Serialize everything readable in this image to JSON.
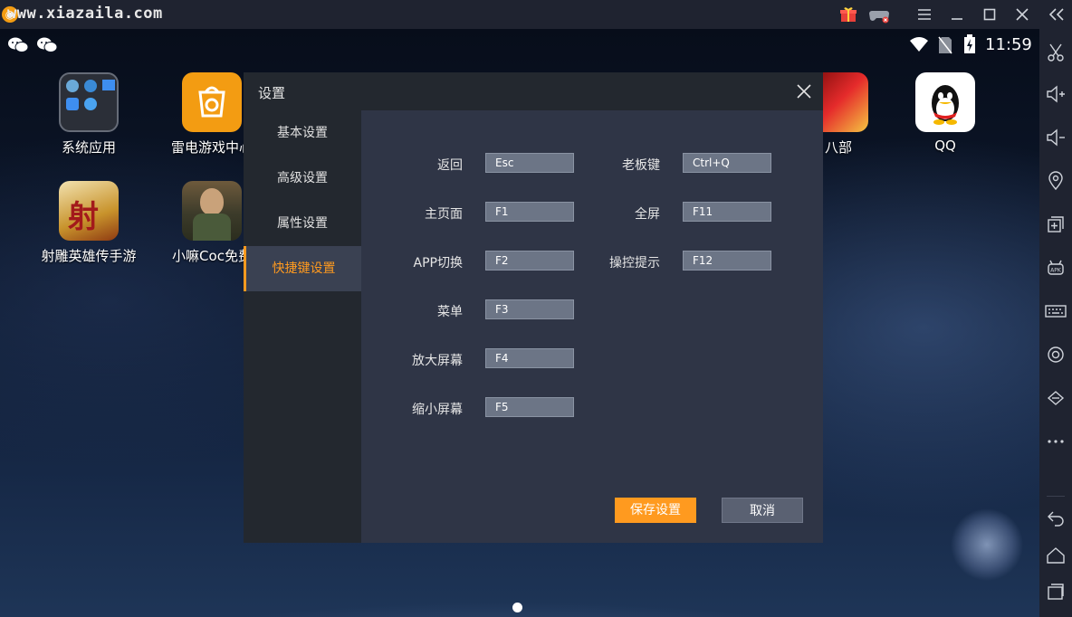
{
  "window": {
    "title": "www.xiazaila.com"
  },
  "status": {
    "time": "11:59"
  },
  "apps": [
    {
      "label": "系统应用"
    },
    {
      "label": "雷电游戏中心"
    },
    {
      "label": "八部"
    },
    {
      "label": "QQ"
    },
    {
      "label": "射雕英雄传手游"
    },
    {
      "label": "小嘛Coc免费"
    }
  ],
  "dialog": {
    "title": "设置",
    "nav": [
      {
        "label": "基本设置"
      },
      {
        "label": "高级设置"
      },
      {
        "label": "属性设置"
      },
      {
        "label": "快捷键设置"
      }
    ],
    "active_nav": "快捷键设置",
    "shortcuts_left": [
      {
        "label": "返回",
        "key": "Esc"
      },
      {
        "label": "主页面",
        "key": "F1"
      },
      {
        "label": "APP切换",
        "key": "F2"
      },
      {
        "label": "菜单",
        "key": "F3"
      },
      {
        "label": "放大屏幕",
        "key": "F4"
      },
      {
        "label": "缩小屏幕",
        "key": "F5"
      }
    ],
    "shortcuts_right": [
      {
        "label": "老板键",
        "key": "Ctrl+Q"
      },
      {
        "label": "全屏",
        "key": "F11"
      },
      {
        "label": "操控提示",
        "key": "F12"
      }
    ],
    "save_label": "保存设置",
    "cancel_label": "取消"
  },
  "colors": {
    "accent": "#ff9a1f",
    "dialog_bg": "#2f3546",
    "sidebar_bg": "#23282f"
  },
  "icons": [
    "gift-icon",
    "gamepad-icon",
    "menu-icon",
    "minimize-icon",
    "maximize-icon",
    "close-icon",
    "collapse-icon",
    "wechat-icon",
    "wifi-icon",
    "no-sim-icon",
    "battery-icon",
    "scissors-icon",
    "volume-up-icon",
    "volume-down-icon",
    "location-icon",
    "multi-window-icon",
    "apk-icon",
    "keyboard-icon",
    "settings-icon",
    "shake-icon",
    "more-icon",
    "back-icon",
    "home-icon",
    "recents-icon"
  ]
}
